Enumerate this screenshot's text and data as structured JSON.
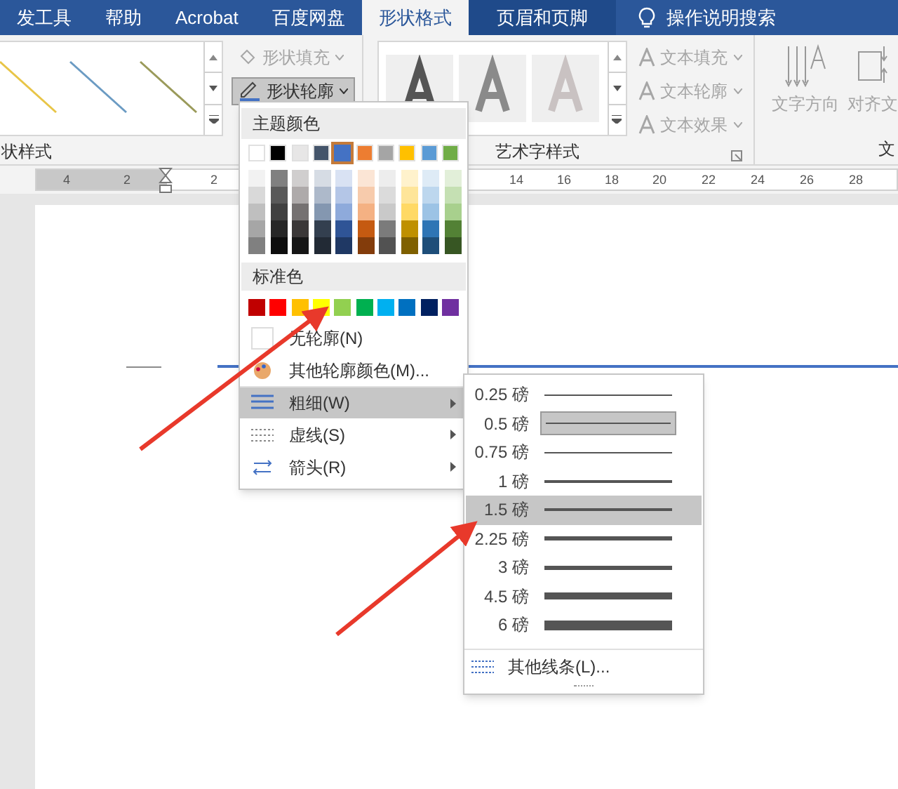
{
  "tabs": [
    {
      "label": "发工具",
      "kind": "normal",
      "selected": false
    },
    {
      "label": "帮助",
      "kind": "normal",
      "selected": false
    },
    {
      "label": "Acrobat",
      "kind": "normal",
      "selected": false
    },
    {
      "label": "百度网盘",
      "kind": "normal",
      "selected": false
    },
    {
      "label": "形状格式",
      "kind": "normal",
      "selected": true
    },
    {
      "label": "页眉和页脚",
      "kind": "contextual",
      "selected": false
    }
  ],
  "search": {
    "label": "操作说明搜索"
  },
  "ribbon": {
    "shape_styles": {
      "label": "状样式",
      "buttons": [
        {
          "label": "形状填充",
          "disabled": true,
          "pressed": false
        },
        {
          "label": "形状轮廓",
          "disabled": false,
          "pressed": true
        }
      ]
    },
    "wordart": {
      "label": "艺术字样式",
      "buttons": [
        {
          "label": "文本填充",
          "disabled": true
        },
        {
          "label": "文本轮廓",
          "disabled": true
        },
        {
          "label": "文本效果",
          "disabled": true
        }
      ]
    },
    "text": {
      "label": "文",
      "buttons": [
        {
          "label": "文字方向"
        },
        {
          "label": "对齐文"
        }
      ]
    }
  },
  "ruler": {
    "numbers": [
      "4",
      "2",
      "2",
      "14",
      "16",
      "18",
      "20",
      "22",
      "24",
      "26",
      "28"
    ]
  },
  "outline_menu": {
    "theme_header": "主题颜色",
    "theme_colors": [
      {
        "color": "#ffffff",
        "selected": false,
        "shades": [
          {
            "color": "#f2f2f2"
          },
          {
            "color": "#d9d9d9"
          },
          {
            "color": "#bfbfbf"
          },
          {
            "color": "#a6a6a6"
          },
          {
            "color": "#808080"
          }
        ]
      },
      {
        "color": "#000000",
        "selected": false,
        "shades": [
          {
            "color": "#808080"
          },
          {
            "color": "#595959"
          },
          {
            "color": "#404040"
          },
          {
            "color": "#262626"
          },
          {
            "color": "#0d0d0d"
          }
        ]
      },
      {
        "color": "#e7e6e6",
        "selected": false,
        "shades": [
          {
            "color": "#d0cece"
          },
          {
            "color": "#aeaaaa"
          },
          {
            "color": "#757171"
          },
          {
            "color": "#3b3838"
          },
          {
            "color": "#161616"
          }
        ]
      },
      {
        "color": "#44546a",
        "selected": false,
        "shades": [
          {
            "color": "#d6dce4"
          },
          {
            "color": "#adb9ca"
          },
          {
            "color": "#8497b0"
          },
          {
            "color": "#333f4f"
          },
          {
            "color": "#222a35"
          }
        ]
      },
      {
        "color": "#4472c4",
        "selected": true,
        "shades": [
          {
            "color": "#d9e2f3"
          },
          {
            "color": "#b4c6e7"
          },
          {
            "color": "#8eaadb"
          },
          {
            "color": "#2f5496"
          },
          {
            "color": "#1f3864"
          }
        ]
      },
      {
        "color": "#ed7d31",
        "selected": false,
        "shades": [
          {
            "color": "#fbe5d5"
          },
          {
            "color": "#f7cbac"
          },
          {
            "color": "#f4b183"
          },
          {
            "color": "#c55a11"
          },
          {
            "color": "#833c0b"
          }
        ]
      },
      {
        "color": "#a5a5a5",
        "selected": false,
        "shades": [
          {
            "color": "#ededed"
          },
          {
            "color": "#dbdbdb"
          },
          {
            "color": "#c9c9c9"
          },
          {
            "color": "#7b7b7b"
          },
          {
            "color": "#525252"
          }
        ]
      },
      {
        "color": "#ffc000",
        "selected": false,
        "shades": [
          {
            "color": "#fff2cc"
          },
          {
            "color": "#fee599"
          },
          {
            "color": "#ffd965"
          },
          {
            "color": "#bf9000"
          },
          {
            "color": "#7f6000"
          }
        ]
      },
      {
        "color": "#5b9bd5",
        "selected": false,
        "shades": [
          {
            "color": "#deebf6"
          },
          {
            "color": "#bdd7ee"
          },
          {
            "color": "#9cc3e5"
          },
          {
            "color": "#2e75b5"
          },
          {
            "color": "#1e4e79"
          }
        ]
      },
      {
        "color": "#70ad47",
        "selected": false,
        "shades": [
          {
            "color": "#e2efd9"
          },
          {
            "color": "#c5e0b3"
          },
          {
            "color": "#a8d08d"
          },
          {
            "color": "#538135"
          },
          {
            "color": "#375623"
          }
        ]
      }
    ],
    "standard_header": "标准色",
    "standard_colors": [
      {
        "color": "#c00000"
      },
      {
        "color": "#ff0000"
      },
      {
        "color": "#ffc000"
      },
      {
        "color": "#ffff00"
      },
      {
        "color": "#92d050"
      },
      {
        "color": "#00b050"
      },
      {
        "color": "#00b0f0"
      },
      {
        "color": "#0070c0"
      },
      {
        "color": "#002060"
      },
      {
        "color": "#7030a0"
      }
    ],
    "items": [
      {
        "kind": "no_outline",
        "label": "无轮廓(N)",
        "highlighted": false,
        "submenu": false
      },
      {
        "kind": "more_colors",
        "label": "其他轮廓颜色(M)...",
        "highlighted": false,
        "submenu": false
      },
      {
        "kind": "weight",
        "label": "粗细(W)",
        "highlighted": true,
        "submenu": true
      },
      {
        "kind": "dashes",
        "label": "虚线(S)",
        "highlighted": false,
        "submenu": true
      },
      {
        "kind": "arrows",
        "label": "箭头(R)",
        "highlighted": false,
        "submenu": true
      }
    ]
  },
  "weight_menu": {
    "items": [
      {
        "label": "0.25 磅",
        "selected": false,
        "highlighted": false
      },
      {
        "label": "0.5 磅",
        "selected": true,
        "highlighted": false
      },
      {
        "label": "0.75 磅",
        "selected": false,
        "highlighted": false
      },
      {
        "label": "1 磅",
        "selected": false,
        "highlighted": false
      },
      {
        "label": "1.5 磅",
        "selected": false,
        "highlighted": true
      },
      {
        "label": "2.25 磅",
        "selected": false,
        "highlighted": false
      },
      {
        "label": "3 磅",
        "selected": false,
        "highlighted": false
      },
      {
        "label": "4.5 磅",
        "selected": false,
        "highlighted": false
      },
      {
        "label": "6 磅",
        "selected": false,
        "highlighted": false
      }
    ],
    "more": "其他线条(L)..."
  }
}
